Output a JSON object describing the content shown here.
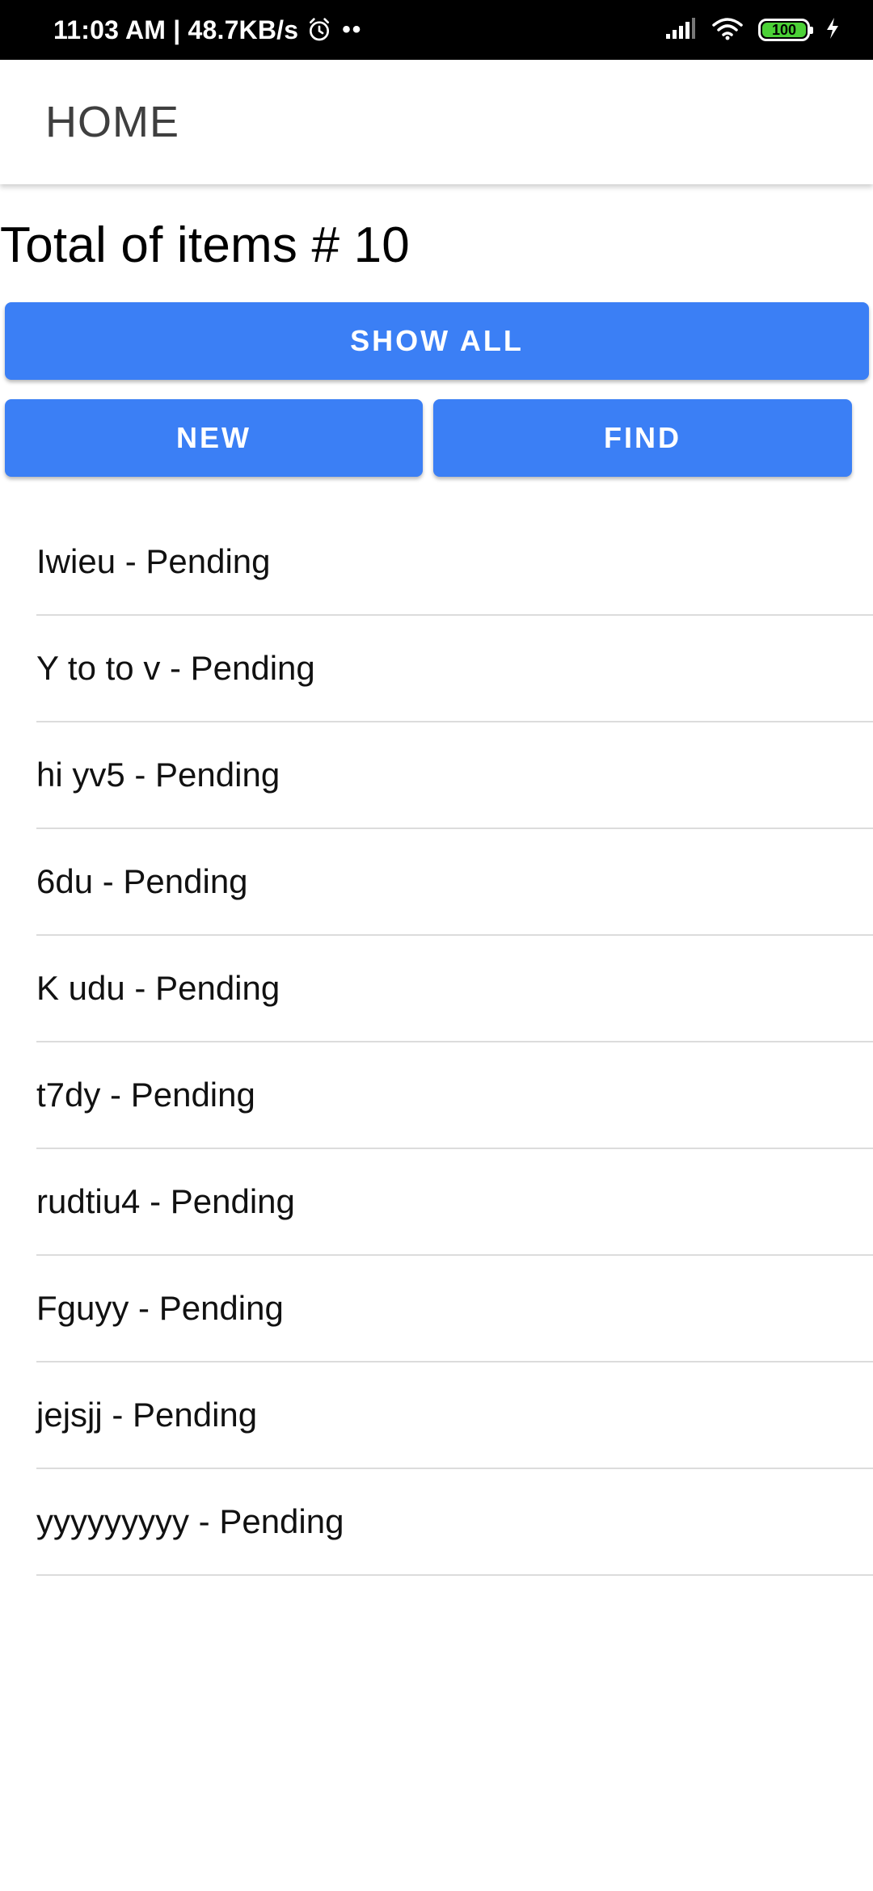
{
  "status_bar": {
    "time_speed": "11:03 AM | 48.7KB/s",
    "dots": "••",
    "battery": "100",
    "icons": [
      "alarm-icon",
      "signal-icon",
      "wifi-icon",
      "battery-icon",
      "charging-icon"
    ]
  },
  "app_bar": {
    "title": "HOME"
  },
  "summary": {
    "total_text": "Total of items # 10"
  },
  "buttons": {
    "show_all": "SHOW ALL",
    "new": "NEW",
    "find": "FIND"
  },
  "items": [
    "Iwieu - Pending",
    "Y to to v - Pending",
    "hi yv5 - Pending",
    "6du - Pending",
    "K udu - Pending",
    "t7dy - Pending",
    "rudtiu4 - Pending",
    "Fguyy - Pending",
    "jejsjj - Pending",
    "yyyyyyyyy - Pending"
  ],
  "colors": {
    "primary": "#3b7ff5",
    "status_bar_bg": "#000000",
    "battery_fill": "#4cd137",
    "divider": "#dcdcdc"
  }
}
